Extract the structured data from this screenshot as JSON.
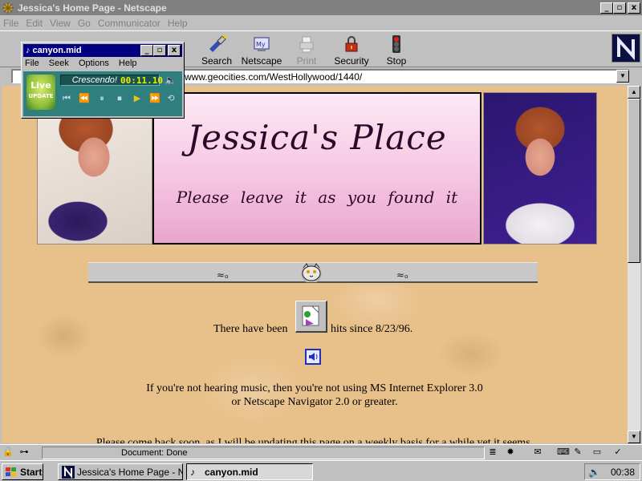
{
  "window": {
    "title": "Jessica's Home Page - Netscape",
    "minimize_glyph": "_",
    "restore_glyph": "▫",
    "close_glyph": "x"
  },
  "menu": {
    "items": [
      "File",
      "Edit",
      "View",
      "Go",
      "Communicator",
      "Help"
    ]
  },
  "toolbar": {
    "buttons": [
      {
        "label": "Search",
        "icon": "search-flashlight-icon",
        "enabled": true
      },
      {
        "label": "Netscape",
        "icon": "my-netscape-icon",
        "enabled": true
      },
      {
        "label": "Print",
        "icon": "printer-icon",
        "enabled": false
      },
      {
        "label": "Security",
        "icon": "padlock-icon",
        "enabled": true
      },
      {
        "label": "Stop",
        "icon": "stop-traffic-light-icon",
        "enabled": true
      }
    ],
    "logo": "netscape-n-logo"
  },
  "location": {
    "url_visible": "www.geocities.com/WestHollywood/1440/"
  },
  "page": {
    "banner_title": "Jessica's Place",
    "banner_subtitle": "Please leave it as you found it",
    "hits_pre": "There have been",
    "hits_post": "hits since 8/23/96.",
    "message_line1": "If you're not hearing music, then you're not using MS Internet Explorer 3.0",
    "message_line2": "or Netscape Navigator 2.0 or greater.",
    "message_line3": "Please come back soon, as I will be updating this page on a weekly basis for a while yet it seems."
  },
  "status": {
    "text": "Document: Done"
  },
  "taskbar": {
    "start_label": "Start",
    "tasks": [
      {
        "label": "Jessica's Home Page - Net...",
        "active": false
      },
      {
        "label": "canyon.mid",
        "active": true
      }
    ],
    "clock": "00:38"
  },
  "player": {
    "title": "canyon.mid",
    "menu": [
      "File",
      "Seek",
      "Options",
      "Help"
    ],
    "badge_line1": "Live",
    "badge_line2": "UPDATE",
    "track_name": "Crescendo!",
    "time": "00:11.10"
  },
  "colors": {
    "titlebar_inactive": "#808080",
    "player_titlebar": "#000080",
    "player_body": "#2f7f7f",
    "page_background": "#e8c08a",
    "banner_pink": "#f6c6e2"
  }
}
